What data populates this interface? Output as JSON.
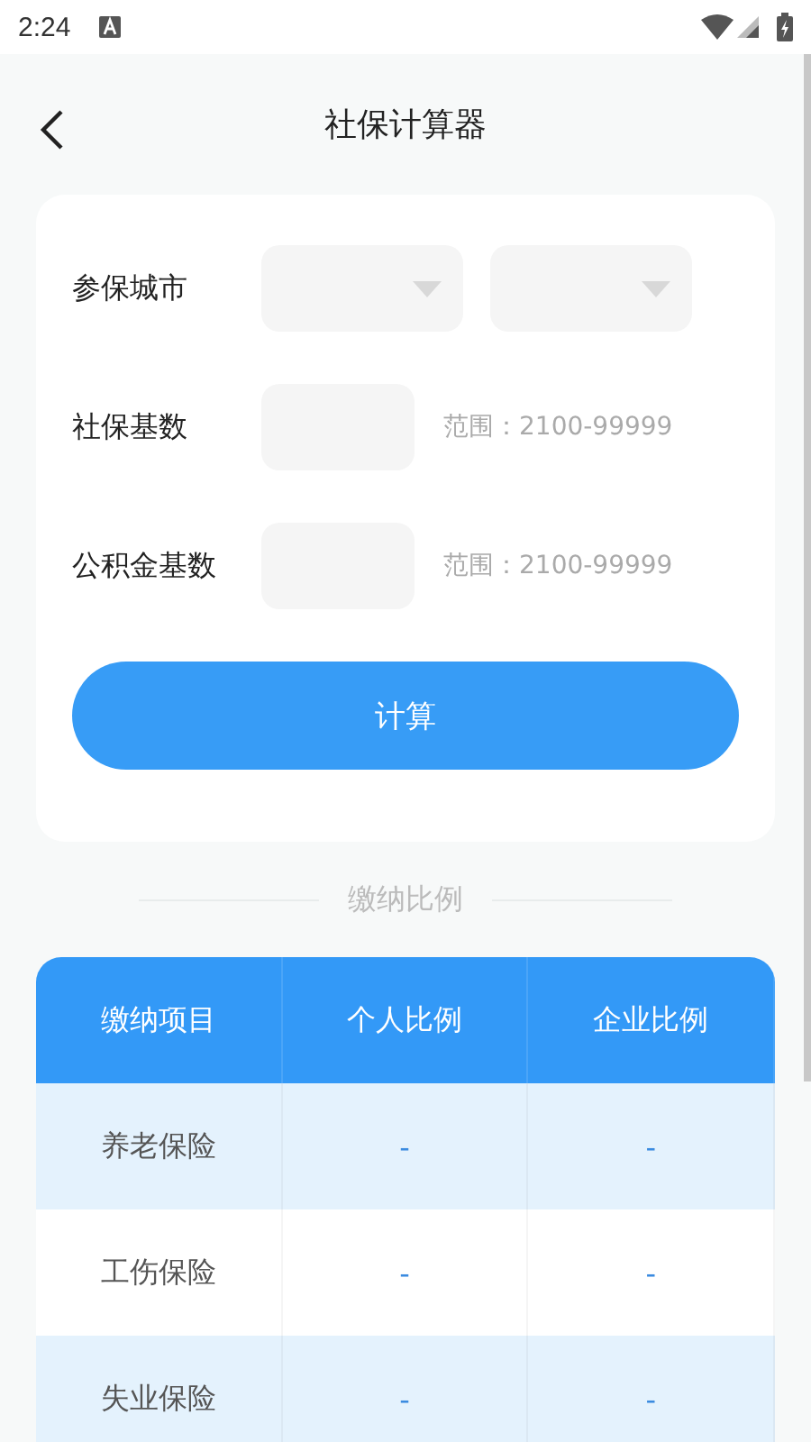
{
  "status_bar": {
    "time": "2:24"
  },
  "header": {
    "title": "社保计算器"
  },
  "form": {
    "rows": [
      {
        "kind": "selects",
        "label": "参保城市"
      },
      {
        "kind": "input",
        "label": "社保基数",
        "hint": "范围：2100-99999"
      },
      {
        "kind": "input",
        "label": "公积金基数",
        "hint": "范围：2100-99999"
      }
    ],
    "button": "计算"
  },
  "section_title": "缴纳比例",
  "table": {
    "columns": [
      "缴纳项目",
      "个人比例",
      "企业比例"
    ],
    "rows": [
      {
        "cells": [
          "养老保险",
          "-",
          "-"
        ]
      },
      {
        "cells": [
          "工伤保险",
          "-",
          "-"
        ]
      },
      {
        "cells": [
          "失业保险",
          "-",
          "-"
        ]
      }
    ]
  }
}
